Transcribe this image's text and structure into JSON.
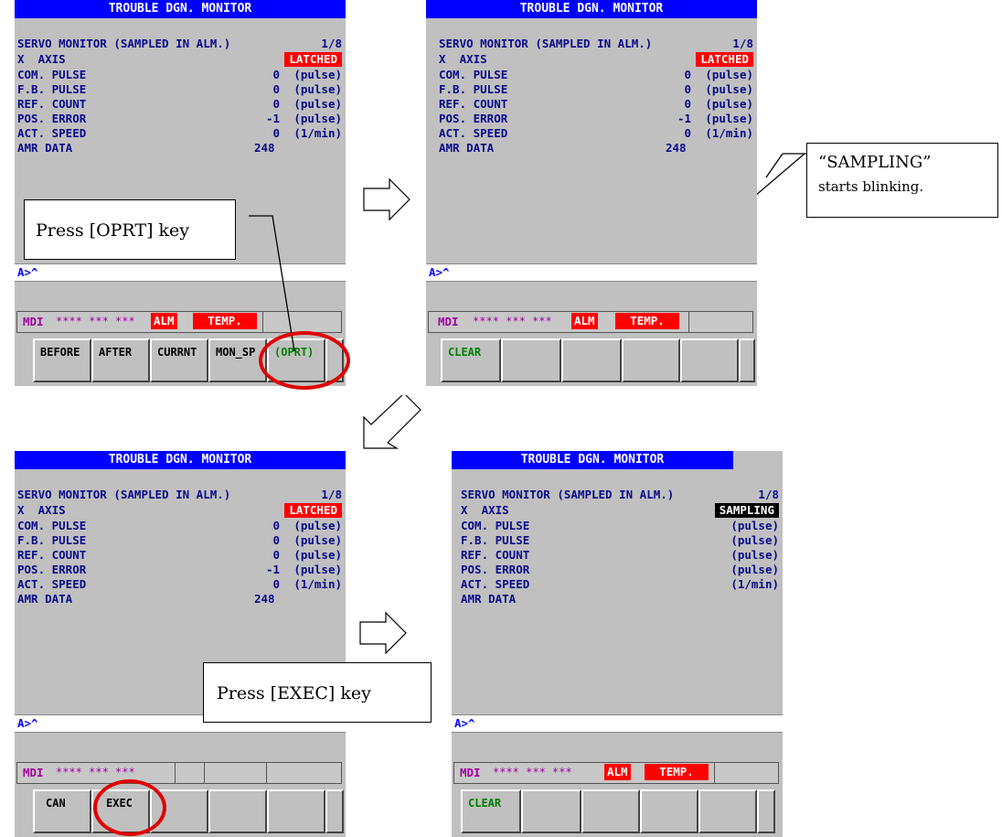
{
  "screen": {
    "title": "TROUBLE DGN. MONITOR",
    "header": "SERVO MONITOR (SAMPLED IN ALM.)",
    "page": "1/8",
    "axis": "X  AXIS",
    "rows": [
      {
        "label": "COM. PULSE",
        "value": "0",
        "unit": "(pulse)"
      },
      {
        "label": "F.B. PULSE",
        "value": "0",
        "unit": "(pulse)"
      },
      {
        "label": "REF. COUNT",
        "value": "0",
        "unit": "(pulse)"
      },
      {
        "label": "POS. ERROR",
        "value": "-1",
        "unit": "(pulse)"
      },
      {
        "label": "ACT. SPEED",
        "value": "0",
        "unit": "(1/min)"
      }
    ],
    "amr_label": "AMR DATA",
    "amr_value": "248",
    "prompt": "A>^",
    "status_mdi": "MDI",
    "status_stars": "**** *** ***",
    "status_alm": "ALM",
    "status_temp": "TEMP.",
    "latched": "LATCHED",
    "sampling": "SAMPLING"
  },
  "softkeys_main": [
    "BEFORE",
    "AFTER",
    "CURRNT",
    "MON_SP",
    "(OPRT)"
  ],
  "softkeys_oprt": [
    "CLEAR"
  ],
  "softkeys_exec": [
    "CAN",
    "EXEC"
  ],
  "callouts": {
    "oprt": "Press [OPRT] key",
    "exec": "Press [EXEC] key",
    "sampling_title": "“SAMPLING”",
    "sampling_sub": "starts blinking."
  },
  "colors": {
    "title_bar": "#0000ff",
    "alarm": "#ff0000",
    "text": "#0a0a8c",
    "softkey_green": "#008000"
  }
}
